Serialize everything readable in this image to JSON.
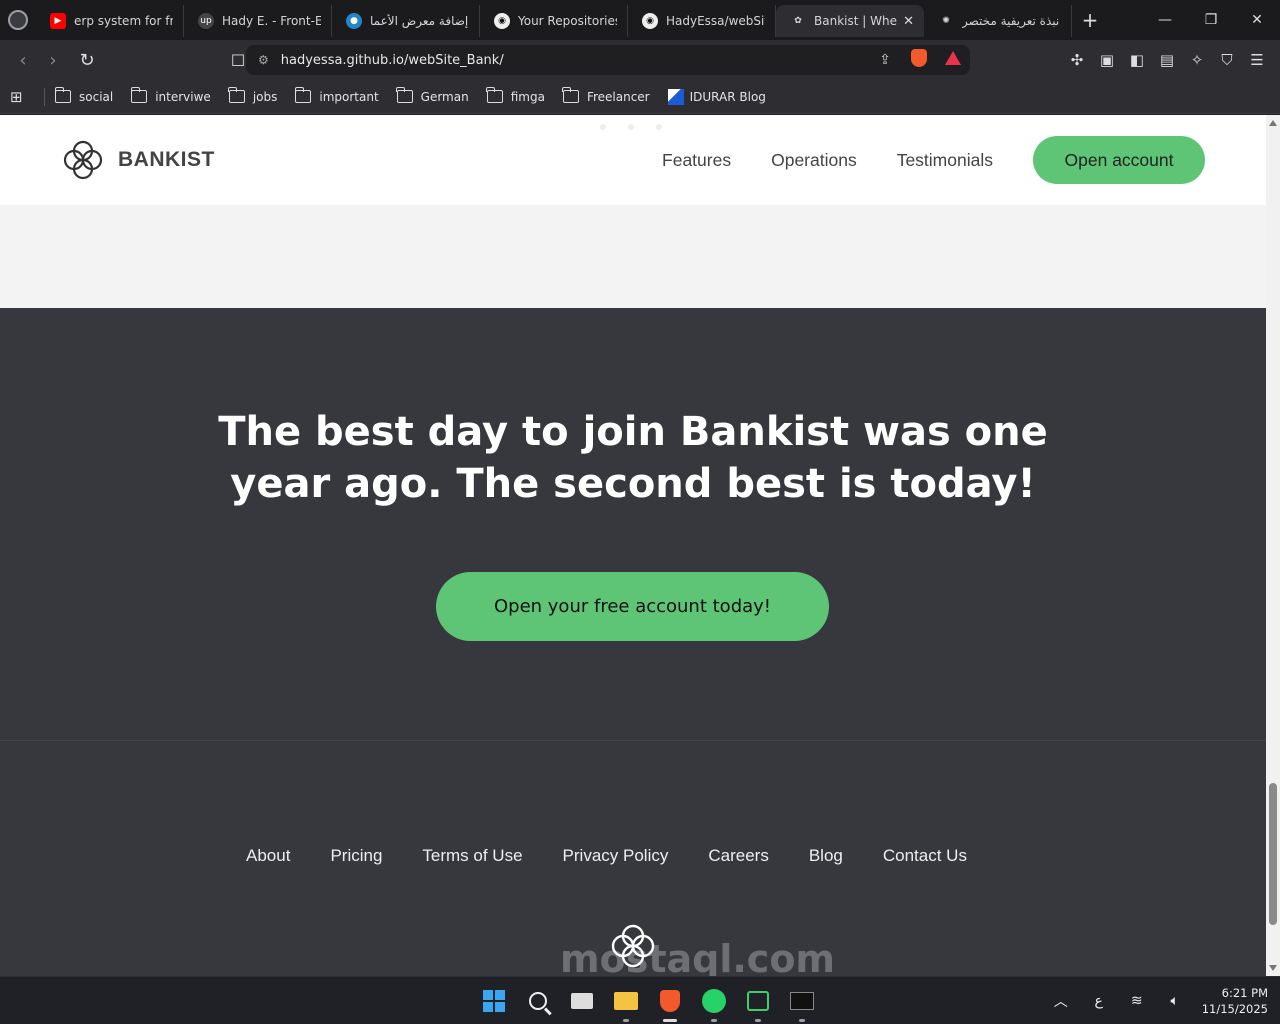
{
  "browser": {
    "tabs": [
      {
        "title": "erp system for fron",
        "icon": "youtube-icon",
        "color": "#ff0000"
      },
      {
        "title": "Hady E. - Front-End",
        "icon": "upwork-icon",
        "color": "#444"
      },
      {
        "title": "إضافة معرض الأعما",
        "icon": "mostaql-icon",
        "color": "#2386c8"
      },
      {
        "title": "Your Repositories",
        "icon": "github-icon",
        "color": "#333"
      },
      {
        "title": "HadyEssa/webSite",
        "icon": "github-icon",
        "color": "#333"
      },
      {
        "title": "Bankist | When",
        "icon": "bankist-icon",
        "color": "#333",
        "active": true
      },
      {
        "title": "نبذة تعريفية مختصر",
        "icon": "chatgpt-icon",
        "color": "#333"
      }
    ],
    "url": "hadyessa.github.io/webSite_Bank/",
    "bookmarks": [
      "social",
      "interviwe",
      "jobs",
      "important",
      "German",
      "fimga",
      "Freelancer",
      "IDURAR Blog"
    ]
  },
  "site": {
    "brand": "BANKIST",
    "nav": [
      "Features",
      "Operations",
      "Testimonials"
    ],
    "nav_cta": "Open account",
    "signup_title_line1": "The best day to join Bankist was one",
    "signup_title_line2": "year ago. The second best is today!",
    "signup_cta": "Open your free account today!",
    "footer_links": [
      "About",
      "Pricing",
      "Terms of Use",
      "Privacy Policy",
      "Careers",
      "Blog",
      "Contact Us"
    ],
    "watermark": "mostaql.com",
    "accent": "#5ec576",
    "dark_bg": "#37383d"
  },
  "taskbar": {
    "lang": "ع",
    "time": "6:21 PM",
    "date": "11/15/2025"
  }
}
